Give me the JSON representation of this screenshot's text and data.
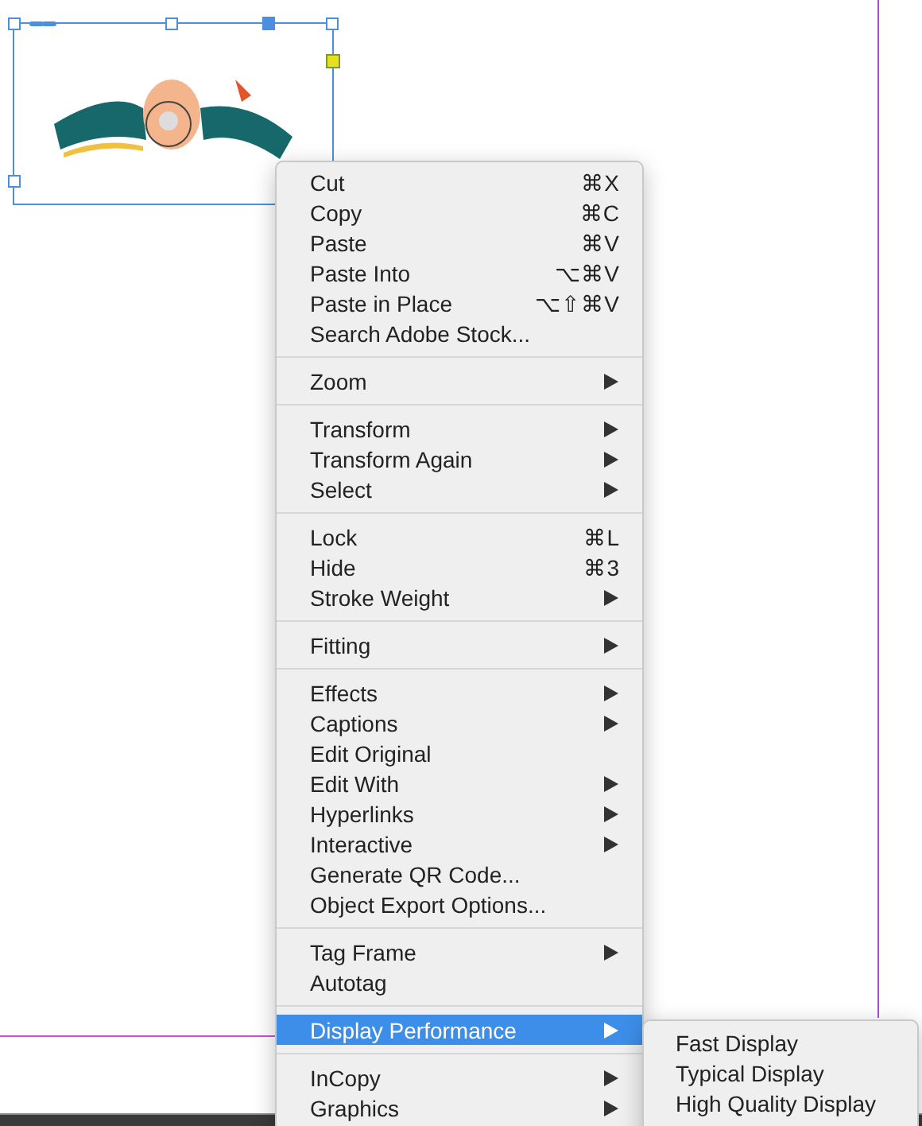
{
  "context_menu": {
    "groups": [
      {
        "items": [
          {
            "label": "Cut",
            "shortcut": "⌘X",
            "submenu": false,
            "selected": false
          },
          {
            "label": "Copy",
            "shortcut": "⌘C",
            "submenu": false,
            "selected": false
          },
          {
            "label": "Paste",
            "shortcut": "⌘V",
            "submenu": false,
            "selected": false
          },
          {
            "label": "Paste Into",
            "shortcut": "⌥⌘V",
            "submenu": false,
            "selected": false
          },
          {
            "label": "Paste in Place",
            "shortcut": "⌥⇧⌘V",
            "submenu": false,
            "selected": false
          },
          {
            "label": "Search Adobe Stock...",
            "submenu": false,
            "selected": false
          }
        ]
      },
      {
        "items": [
          {
            "label": "Zoom",
            "submenu": true,
            "selected": false
          }
        ]
      },
      {
        "items": [
          {
            "label": "Transform",
            "submenu": true,
            "selected": false
          },
          {
            "label": "Transform Again",
            "submenu": true,
            "selected": false
          },
          {
            "label": "Select",
            "submenu": true,
            "selected": false
          }
        ]
      },
      {
        "items": [
          {
            "label": "Lock",
            "shortcut": "⌘L",
            "submenu": false,
            "selected": false
          },
          {
            "label": "Hide",
            "shortcut": "⌘3",
            "submenu": false,
            "selected": false
          },
          {
            "label": "Stroke Weight",
            "submenu": true,
            "selected": false
          }
        ]
      },
      {
        "items": [
          {
            "label": "Fitting",
            "submenu": true,
            "selected": false
          }
        ]
      },
      {
        "items": [
          {
            "label": "Effects",
            "submenu": true,
            "selected": false
          },
          {
            "label": "Captions",
            "submenu": true,
            "selected": false
          },
          {
            "label": "Edit Original",
            "submenu": false,
            "selected": false
          },
          {
            "label": "Edit With",
            "submenu": true,
            "selected": false
          },
          {
            "label": "Hyperlinks",
            "submenu": true,
            "selected": false
          },
          {
            "label": "Interactive",
            "submenu": true,
            "selected": false
          },
          {
            "label": "Generate QR Code...",
            "submenu": false,
            "selected": false
          },
          {
            "label": "Object Export Options...",
            "submenu": false,
            "selected": false
          }
        ]
      },
      {
        "items": [
          {
            "label": "Tag Frame",
            "submenu": true,
            "selected": false
          },
          {
            "label": "Autotag",
            "submenu": false,
            "selected": false
          }
        ]
      },
      {
        "items": [
          {
            "label": "Display Performance",
            "submenu": true,
            "selected": true
          }
        ]
      },
      {
        "items": [
          {
            "label": "InCopy",
            "submenu": true,
            "selected": false
          },
          {
            "label": "Graphics",
            "submenu": true,
            "selected": false
          }
        ]
      }
    ]
  },
  "submenu": {
    "items": [
      {
        "label": "Fast Display",
        "selected": false
      },
      {
        "label": "Typical Display",
        "selected": false
      },
      {
        "label": "High Quality Display",
        "selected": false
      }
    ]
  }
}
